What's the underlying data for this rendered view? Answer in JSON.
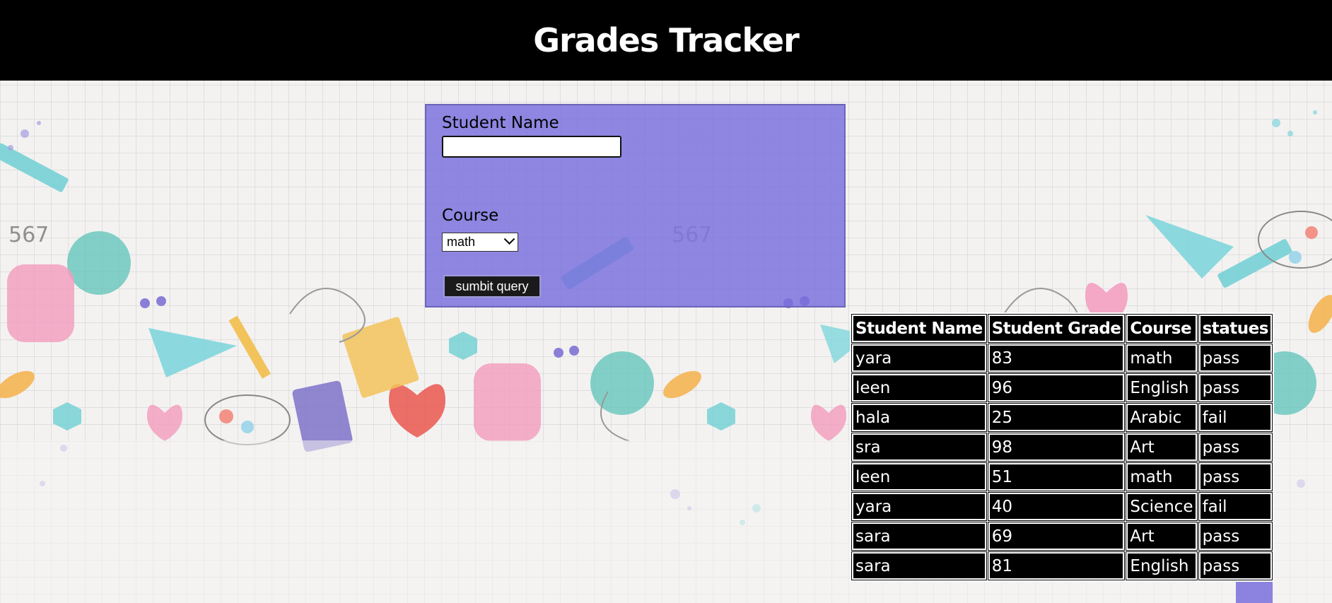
{
  "header": {
    "title": "Grades Tracker"
  },
  "form": {
    "name_label": "Student Name",
    "name_value": "",
    "course_label": "Course",
    "course_selected": "math",
    "submit_label": "sumbit query"
  },
  "table": {
    "headers": [
      "Student Name",
      "Student Grade",
      "Course",
      "statues"
    ],
    "rows": [
      [
        "yara",
        "83",
        "math",
        "pass"
      ],
      [
        "leen",
        "96",
        "English",
        "pass"
      ],
      [
        "hala",
        "25",
        "Arabic",
        "fail"
      ],
      [
        "sra",
        "98",
        "Art",
        "pass"
      ],
      [
        "leen",
        "51",
        "math",
        "pass"
      ],
      [
        "yara",
        "40",
        "Science",
        "fail"
      ],
      [
        "sara",
        "69",
        "Art",
        "pass"
      ],
      [
        "sara",
        "81",
        "English",
        "pass"
      ]
    ]
  },
  "colors": {
    "header_bg": "#000000",
    "panel_accent": "#786edc",
    "table_cell_bg": "#000000",
    "table_text": "#ffffff"
  }
}
